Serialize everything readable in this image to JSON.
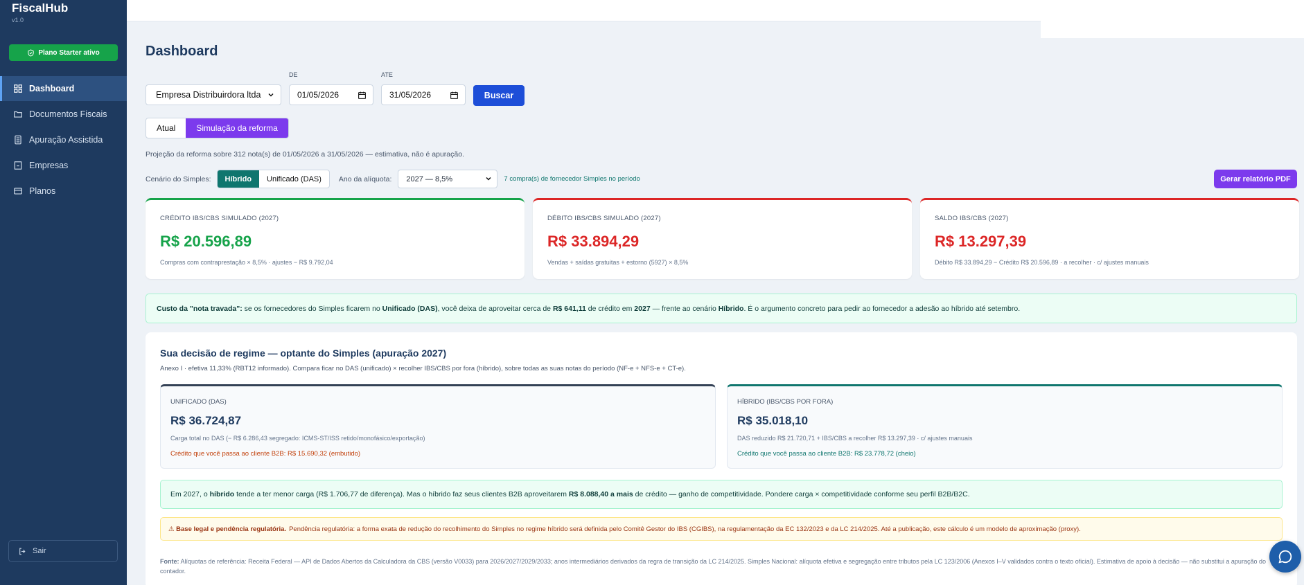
{
  "app": {
    "name": "FiscalHub",
    "version": "v1.0",
    "plan_badge": "Plano Starter ativo"
  },
  "sidebar": {
    "items": [
      {
        "label": "Dashboard",
        "icon": "dashboard-grid-icon",
        "active": true
      },
      {
        "label": "Documentos Fiscais",
        "icon": "folder-icon",
        "active": false
      },
      {
        "label": "Apuração Assistida",
        "icon": "calculator-icon",
        "active": false
      },
      {
        "label": "Empresas",
        "icon": "building-icon",
        "active": false
      },
      {
        "label": "Planos",
        "icon": "card-icon",
        "active": false
      }
    ],
    "logout": "Sair"
  },
  "page": {
    "title": "Dashboard"
  },
  "filters": {
    "company": "Empresa Distribuirdora ltda",
    "de_label": "DE",
    "de_value": "01/05/2026",
    "ate_label": "ATE",
    "ate_value": "31/05/2026",
    "search_button": "Buscar"
  },
  "mode_tabs": {
    "atual": "Atual",
    "simulacao": "Simulação da reforma",
    "active": "simulacao"
  },
  "projection_note": "Projeção da reforma sobre 312 nota(s) de 01/05/2026 a 31/05/2026 — estimativa, não é apuração.",
  "scenario": {
    "label": "Cenário do Simples:",
    "hibrido": "Híbrido",
    "unificado": "Unificado (DAS)",
    "active": "hibrido",
    "ano_label": "Ano da alíquota:",
    "ano_value": "2027 — 8,5%",
    "supplier_note": "7 compra(s) de fornecedor Simples no período",
    "pdf_button": "Gerar relatório PDF"
  },
  "kpis": {
    "credito": {
      "label": "CRÉDITO IBS/CBS SIMULADO (2027)",
      "value": "R$ 20.596,89",
      "sub": "Compras com contraprestação × 8,5% · ajustes − R$ 9.792,04",
      "color": "#16a34a"
    },
    "debito": {
      "label": "DÉBITO IBS/CBS SIMULADO (2027)",
      "value": "R$ 33.894,29",
      "sub": "Vendas + saídas gratuitas + estorno (5927) × 8,5%",
      "color": "#dc2626"
    },
    "saldo": {
      "label": "SALDO IBS/CBS (2027)",
      "value": "R$ 13.297,39",
      "sub": "Débito R$ 33.894,29 − Crédito R$ 20.596,89 · a recolher · c/ ajustes manuais",
      "color": "#dc2626"
    }
  },
  "alert": {
    "p1": "Custo da \"nota travada\":",
    "p2": " se os fornecedores do Simples ficarem no ",
    "p3": "Unificado (DAS)",
    "p4": ", você deixa de aproveitar cerca de ",
    "p5": "R$ 641,11",
    "p6": " de crédito em ",
    "p7": "2027",
    "p8": " — frente ao cenário ",
    "p9": "Híbrido",
    "p10": ". É o argumento concreto para pedir ao fornecedor a adesão ao híbrido até setembro."
  },
  "decision": {
    "title": "Sua decisão de regime — optante do Simples (apuração 2027)",
    "subtitle": "Anexo I · efetiva 11,33% (RBT12 informado). Compara ficar no DAS (unificado) × recolher IBS/CBS por fora (híbrido), sobre todas as suas notas do período (NF-e + NFS-e + CT-e).",
    "unificado": {
      "label": "UNIFICADO (DAS)",
      "value": "R$ 36.724,87",
      "sub": "Carga total no DAS (− R$ 6.286,43 segregado: ICMS-ST/ISS retido/monofásico/exportação)",
      "credit": "Crédito que você passa ao cliente B2B: R$ 15.690,32 (embutido)",
      "color": "#334155"
    },
    "hibrido": {
      "label": "HÍBRIDO (IBS/CBS POR FORA)",
      "value": "R$ 35.018,10",
      "sub": "DAS reduzido R$ 21.720,71 + IBS/CBS a recolher R$ 13.297,39 · c/ ajustes manuais",
      "credit": "Crédito que você passa ao cliente B2B: R$ 23.778,72 (cheio)",
      "color": "#0f766e"
    },
    "conclusion": {
      "p1": "Em 2027, o ",
      "p2": "híbrido",
      "p3": " tende a ter menor carga (R$ 1.706,77 de diferença). Mas o híbrido faz seus clientes B2B aproveitarem ",
      "p4": "R$ 8.088,40 a mais",
      "p5": " de crédito — ganho de competitividade. Pondere carga × competitividade conforme seu perfil B2B/B2C."
    },
    "legal": {
      "title": "⚠ Base legal e pendência regulatória.",
      "text": "Pendência regulatória: a forma exata de redução do recolhimento do Simples no regime híbrido será definida pelo Comitê Gestor do IBS (CGIBS), na regulamentação da EC 132/2023 e da LC 214/2025. Até a publicação, este cálculo é um modelo de aproximação (proxy)."
    },
    "source": {
      "label": "Fonte:",
      "text": " Alíquotas de referência: Receita Federal — API de Dados Abertos da Calculadora da CBS (versão V0033) para 2026/2027/2029/2033; anos intermediários derivados da regra de transição da LC 214/2025. Simples Nacional: alíquota efetiva e segregação entre tributos pela LC 123/2006 (Anexos I–V validados contra o texto oficial). Estimativa de apoio à decisão — não substitui a apuração do contador."
    }
  }
}
